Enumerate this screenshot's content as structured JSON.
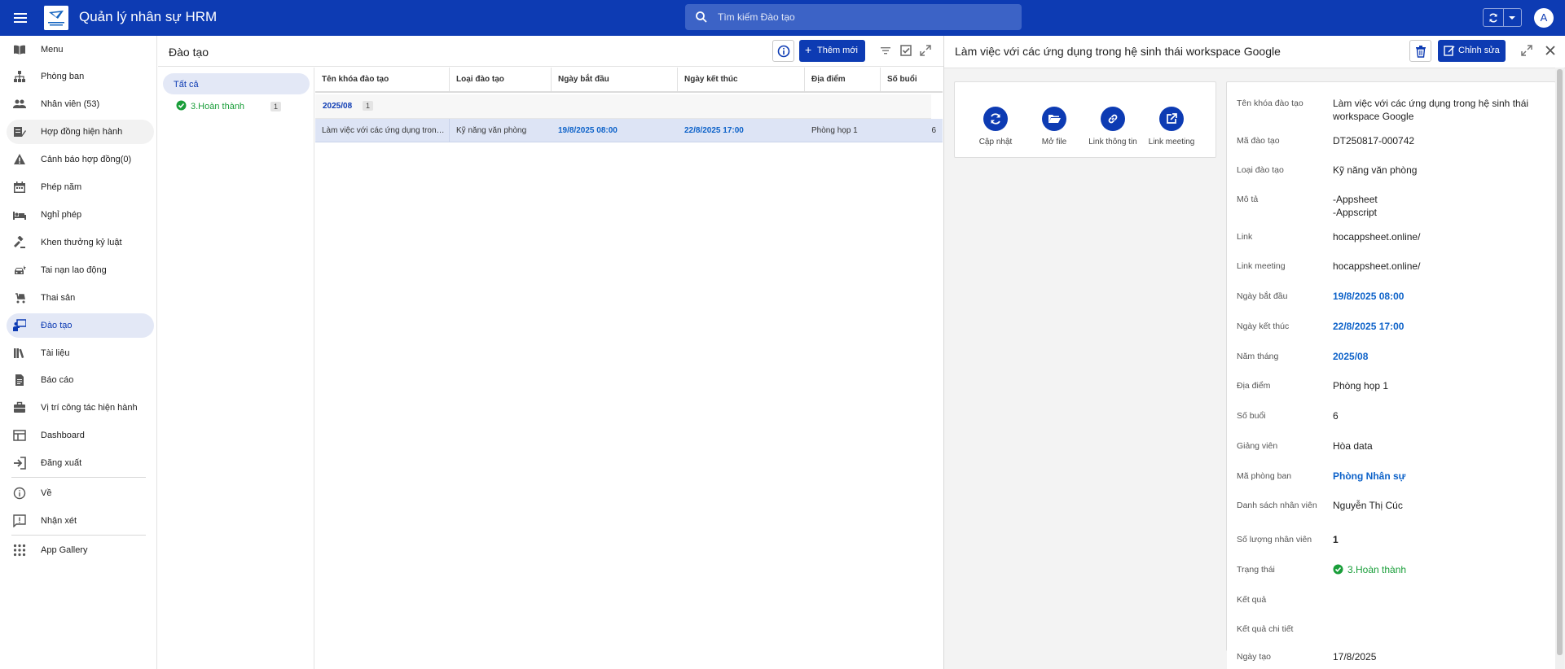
{
  "header": {
    "app_title": "Quản lý nhân sự HRM",
    "search_placeholder": "Tìm kiếm Đào tạo",
    "avatar_initial": "A",
    "brand_color": "#0d3bb3"
  },
  "sidebar": {
    "items": [
      {
        "label": "Menu",
        "icon": "menu-book-icon"
      },
      {
        "label": "Phòng ban",
        "icon": "org-chart-icon"
      },
      {
        "label": "Nhân viên (53)",
        "icon": "people-icon"
      },
      {
        "label": "Hợp đồng hiện hành",
        "icon": "contract-icon"
      },
      {
        "label": "Cảnh báo hợp đồng(0)",
        "icon": "warning-icon"
      },
      {
        "label": "Phép năm",
        "icon": "calendar-icon"
      },
      {
        "label": "Nghỉ phép",
        "icon": "bed-icon"
      },
      {
        "label": "Khen thưởng kỷ luật",
        "icon": "gavel-icon"
      },
      {
        "label": "Tai nạn lao động",
        "icon": "car-crash-icon"
      },
      {
        "label": "Thai sản",
        "icon": "stroller-icon"
      },
      {
        "label": "Đào tạo",
        "icon": "training-icon"
      },
      {
        "label": "Tài liệu",
        "icon": "books-icon"
      },
      {
        "label": "Báo cáo",
        "icon": "report-icon"
      },
      {
        "label": "Vị trí công tác hiện hành",
        "icon": "briefcase-icon"
      },
      {
        "label": "Dashboard",
        "icon": "dashboard-icon"
      },
      {
        "label": "Đăng xuất",
        "icon": "logout-icon"
      },
      {
        "label": "Về",
        "icon": "info-icon"
      },
      {
        "label": "Nhận xét",
        "icon": "feedback-icon"
      },
      {
        "label": "App Gallery",
        "icon": "grid-icon"
      }
    ]
  },
  "list_view": {
    "title": "Đào tạo",
    "add_label": "Thêm mới",
    "groups": {
      "all": "Tất cả",
      "done": "3.Hoàn thành",
      "done_count": "1"
    },
    "columns": [
      "Tên khóa đào tạo",
      "Loại đào tạo",
      "Ngày bắt đầu",
      "Ngày kết thúc",
      "Địa điểm",
      "Số buổi"
    ],
    "group_row": {
      "label": "2025/08",
      "count": "1"
    },
    "rows": [
      [
        "Làm việc với các ứng dụng trong hệ sinh thái workspace Google",
        "Kỹ năng văn phòng",
        "19/8/2025 08:00",
        "22/8/2025 17:00",
        "Phòng họp 1",
        "6"
      ]
    ]
  },
  "detail": {
    "title": "Làm việc với các ứng dụng trong hệ sinh thái workspace Google",
    "edit_label": "Chỉnh sửa",
    "actions": [
      {
        "label": "Cập nhật",
        "icon": "refresh-icon"
      },
      {
        "label": "Mở file",
        "icon": "folder-open-icon"
      },
      {
        "label": "Link thông tin",
        "icon": "link-icon"
      },
      {
        "label": "Link meeting",
        "icon": "external-link-icon"
      }
    ],
    "fields": [
      {
        "label": "Tên khóa đào tạo",
        "value": "Làm việc với các ứng dụng trong hệ sinh thái workspace Google"
      },
      {
        "label": "Mã đào tạo",
        "value": "DT250817-000742"
      },
      {
        "label": "Loại đào tạo",
        "value": "Kỹ năng văn phòng"
      },
      {
        "label": "Mô tả",
        "value": "-Appsheet\n-Appscript"
      },
      {
        "label": "Link",
        "value": "hocappsheet.online/"
      },
      {
        "label": "Link meeting",
        "value": "hocappsheet.online/"
      },
      {
        "label": "Ngày bắt đầu",
        "value": "19/8/2025 08:00"
      },
      {
        "label": "Ngày kết thúc",
        "value": "22/8/2025 17:00"
      },
      {
        "label": "Năm tháng",
        "value": "2025/08"
      },
      {
        "label": "Địa điểm",
        "value": "Phòng họp 1"
      },
      {
        "label": "Số buổi",
        "value": "6"
      },
      {
        "label": "Giảng viên",
        "value": "Hòa data"
      },
      {
        "label": "Mã phòng ban",
        "value": "Phòng Nhân sự"
      },
      {
        "label": "Danh sách nhân viên",
        "value": "Nguyễn Thị Cúc"
      },
      {
        "label": "Số lượng nhân viên",
        "value": "1"
      },
      {
        "label": "Trạng thái",
        "value": "3.Hoàn thành"
      },
      {
        "label": "Kết quả",
        "value": ""
      },
      {
        "label": "Kết quả chi tiết",
        "value": ""
      },
      {
        "label": "Ngày tạo",
        "value": "17/8/2025"
      }
    ]
  }
}
